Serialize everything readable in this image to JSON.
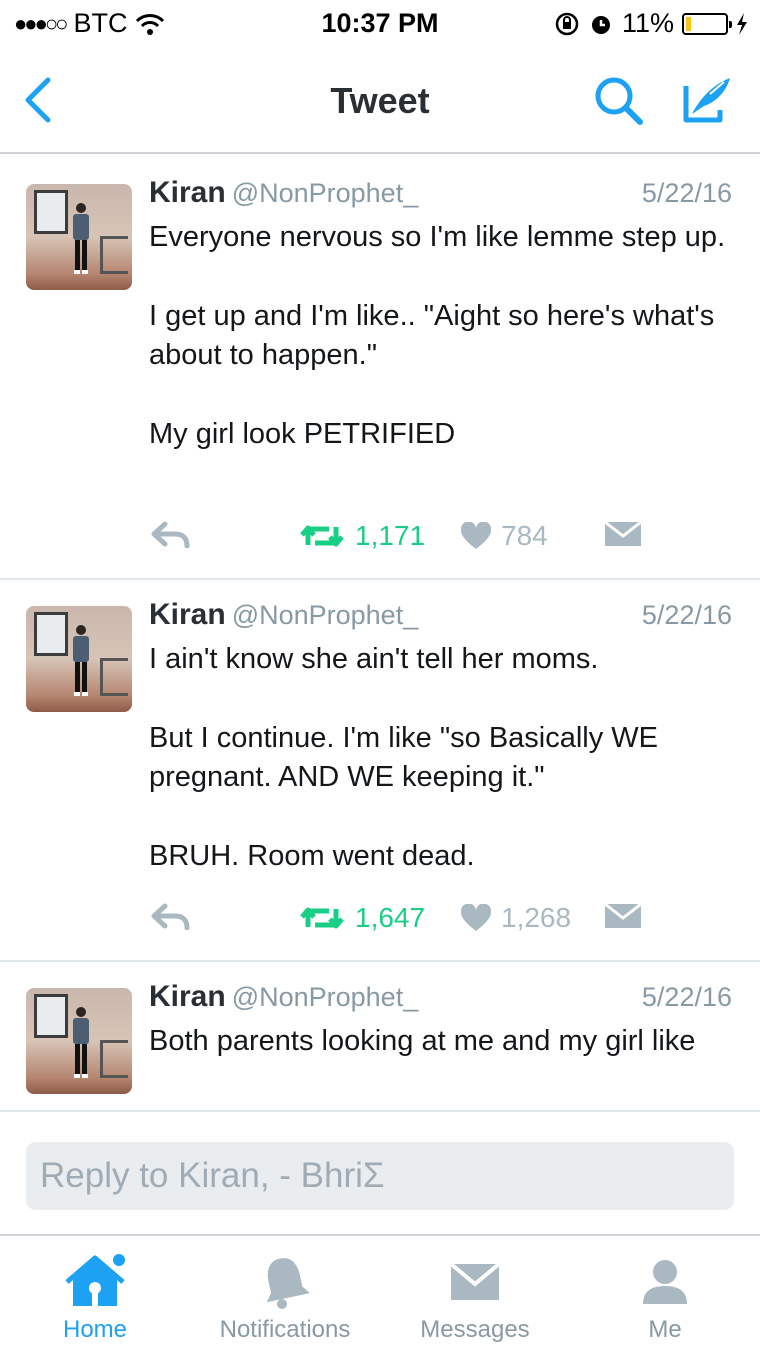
{
  "status_bar": {
    "carrier": "BTC",
    "time": "10:37 PM",
    "battery": "11%"
  },
  "nav": {
    "title": "Tweet"
  },
  "tweets": [
    {
      "name": "Kiran",
      "handle": "@NonProphet_",
      "date": "5/22/16",
      "paragraphs": [
        "Everyone nervous so I'm like lemme step up.",
        "I get up and I'm like.. \"Aight so here's what's about to happen.\"",
        "My girl look PETRIFIED"
      ],
      "retweets": "1,171",
      "likes": "784"
    },
    {
      "name": "Kiran",
      "handle": "@NonProphet_",
      "date": "5/22/16",
      "paragraphs": [
        "I ain't know she ain't tell her moms.",
        "But I continue. I'm like \"so Basically WE pregnant. AND WE keeping it.\"",
        "BRUH. Room went dead."
      ],
      "retweets": "1,647",
      "likes": "1,268"
    },
    {
      "name": "Kiran",
      "handle": "@NonProphet_",
      "date": "5/22/16",
      "paragraphs": [
        "Both parents looking at me and my girl like"
      ]
    }
  ],
  "reply": {
    "placeholder": "Reply to Kiran, - BhriΣ"
  },
  "tabs": [
    {
      "label": "Home",
      "icon": "home-icon",
      "active": true
    },
    {
      "label": "Notifications",
      "icon": "bell-icon"
    },
    {
      "label": "Messages",
      "icon": "envelope-icon"
    },
    {
      "label": "Me",
      "icon": "person-icon"
    }
  ],
  "colors": {
    "accent": "#1da1f2",
    "retweet": "#19cf86",
    "muted": "#8899a6"
  }
}
